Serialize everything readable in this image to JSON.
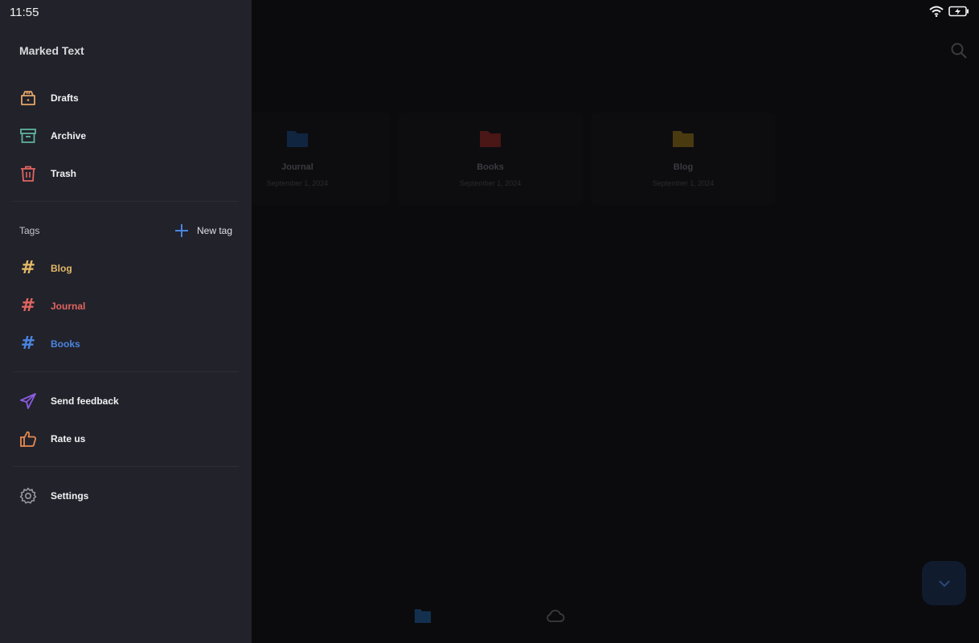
{
  "status": {
    "time": "11:55"
  },
  "drawer": {
    "title": "Marked Text",
    "main_items": [
      {
        "label": "Drafts",
        "icon": "drafts-icon",
        "color": "#e2a766"
      },
      {
        "label": "Archive",
        "icon": "archive-icon",
        "color": "#5fb4a0"
      },
      {
        "label": "Trash",
        "icon": "trash-icon",
        "color": "#e0655f"
      }
    ],
    "tags_label": "Tags",
    "new_tag_label": "New tag",
    "tags": [
      {
        "label": "Blog",
        "color": "#e2b867"
      },
      {
        "label": "Journal",
        "color": "#e0655f"
      },
      {
        "label": "Books",
        "color": "#4a85e0"
      }
    ],
    "extra_items": [
      {
        "label": "Send feedback",
        "icon": "send-icon",
        "color": "#8a5ce0"
      },
      {
        "label": "Rate us",
        "icon": "thumbs-up-icon",
        "color": "#e88a4f"
      }
    ],
    "settings_label": "Settings"
  },
  "folders": [
    {
      "name": "Journal",
      "date": "September 1, 2024",
      "color": "#0f2540"
    },
    {
      "name": "Books",
      "date": "September 1, 2024",
      "color": "#4a1616"
    },
    {
      "name": "Blog",
      "date": "September 1, 2024",
      "color": "#4a3a10"
    }
  ]
}
